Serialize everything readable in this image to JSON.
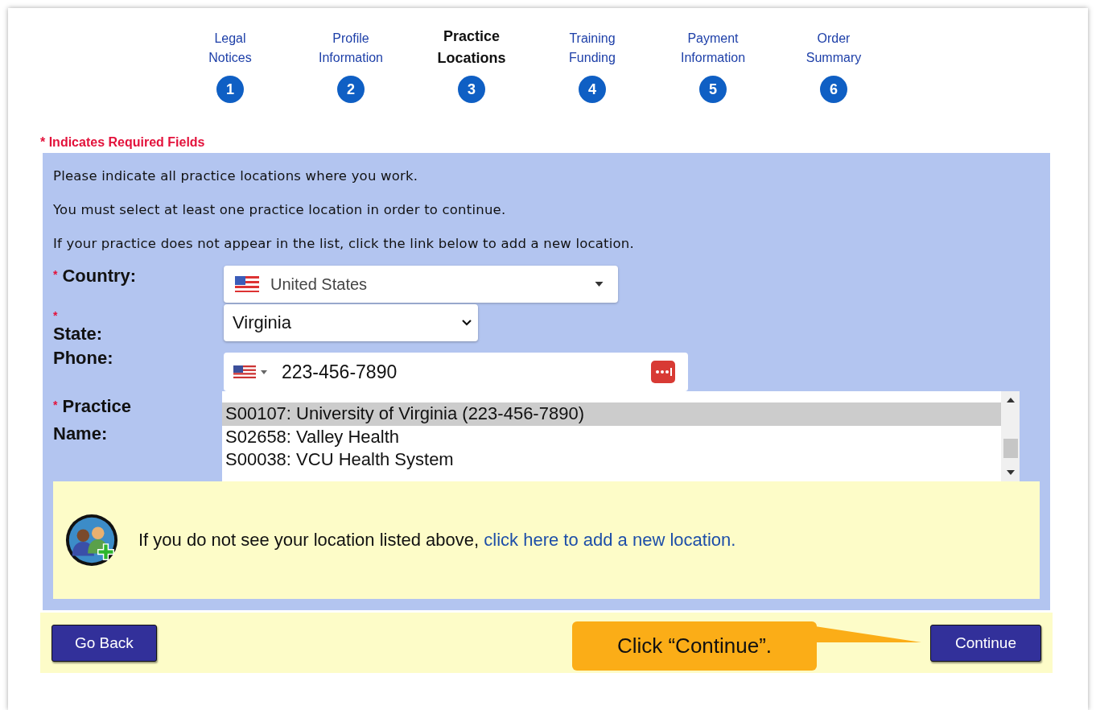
{
  "steps": [
    {
      "label": "Legal Notices",
      "number": "1",
      "selected": false
    },
    {
      "label": "Profile Information",
      "number": "2",
      "selected": false
    },
    {
      "label": "Practice Locations",
      "number": "3",
      "selected": true
    },
    {
      "label": "Training Funding",
      "number": "4",
      "selected": false
    },
    {
      "label": "Payment Information",
      "number": "5",
      "selected": false
    },
    {
      "label": "Order Summary",
      "number": "6",
      "selected": false
    }
  ],
  "required_note": {
    "mark": "*",
    "text": "Indicates Required Fields"
  },
  "instructions": [
    "Please indicate all practice locations where you work.",
    "You must select at least one practice location in order to continue.",
    "If your practice does not appear in the list, click the link below to add a new location."
  ],
  "fields": [
    {
      "kind": "country",
      "label": "Country:",
      "required": true,
      "required_mark": "*",
      "value": "United States"
    },
    {
      "kind": "state",
      "label": "State:",
      "required": true,
      "required_mark": "*",
      "value": "Virginia"
    },
    {
      "kind": "phone",
      "label": "Phone:",
      "required": false,
      "value": "223-456-7890"
    },
    {
      "kind": "list",
      "label": "Practice Name:",
      "required": true,
      "required_mark": "*",
      "options": [
        {
          "text": "S00107: University of Virginia (223-456-7890)",
          "selected": true
        },
        {
          "text": "S02658: Valley Health",
          "selected": false
        },
        {
          "text": "S00038: VCU Health System",
          "selected": false
        }
      ]
    }
  ],
  "add_location": {
    "text": "If you do not see your location listed above,",
    "link": "click here to add a new location."
  },
  "buttons": {
    "back": "Go Back",
    "continue": "Continue"
  },
  "callout": "Click “Continue”."
}
